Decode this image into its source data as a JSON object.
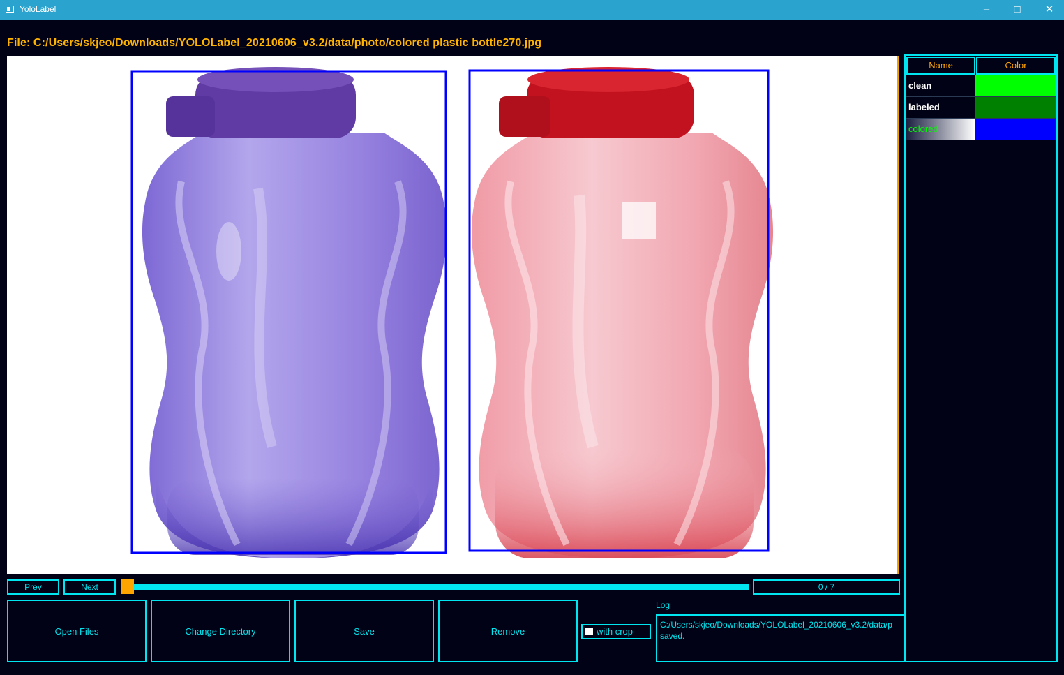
{
  "window": {
    "title": "YoloLabel",
    "minimize_icon": "minimize-icon",
    "maximize_icon": "maximize-icon",
    "close_icon": "close-icon"
  },
  "file": {
    "label": "File: C:/Users/skjeo/Downloads/YOLOLabel_20210606_v3.2/data/photo/colored plastic bottle270.jpg"
  },
  "image": {
    "description_colors": {
      "bottle_left": "#8a73d8",
      "cap_left": "#5c3aa0",
      "bottle_right": "#ef8f98",
      "cap_right": "#c0101e",
      "box": "#0000ff"
    },
    "boxes": [
      {
        "class": "colored"
      },
      {
        "class": "colored"
      }
    ]
  },
  "classes": {
    "headers": {
      "name": "Name",
      "color": "Color"
    },
    "rows": [
      {
        "name": "clean",
        "color": "#00ff00"
      },
      {
        "name": "labeled",
        "color": "#008000"
      },
      {
        "name": "colored",
        "color": "#0000ff",
        "selected": true
      }
    ]
  },
  "nav": {
    "prev": "Prev",
    "next": "Next",
    "counter": "0 / 7",
    "progress": 0
  },
  "actions": {
    "open_files": "Open Files",
    "change_directory": "Change Directory",
    "save": "Save",
    "remove": "Remove",
    "with_crop": "with crop"
  },
  "log": {
    "label": "Log",
    "lines": [
      "C:/Users/skjeo/Downloads/YOLOLabel_20210606_v3.2/data/p",
      "saved."
    ]
  }
}
